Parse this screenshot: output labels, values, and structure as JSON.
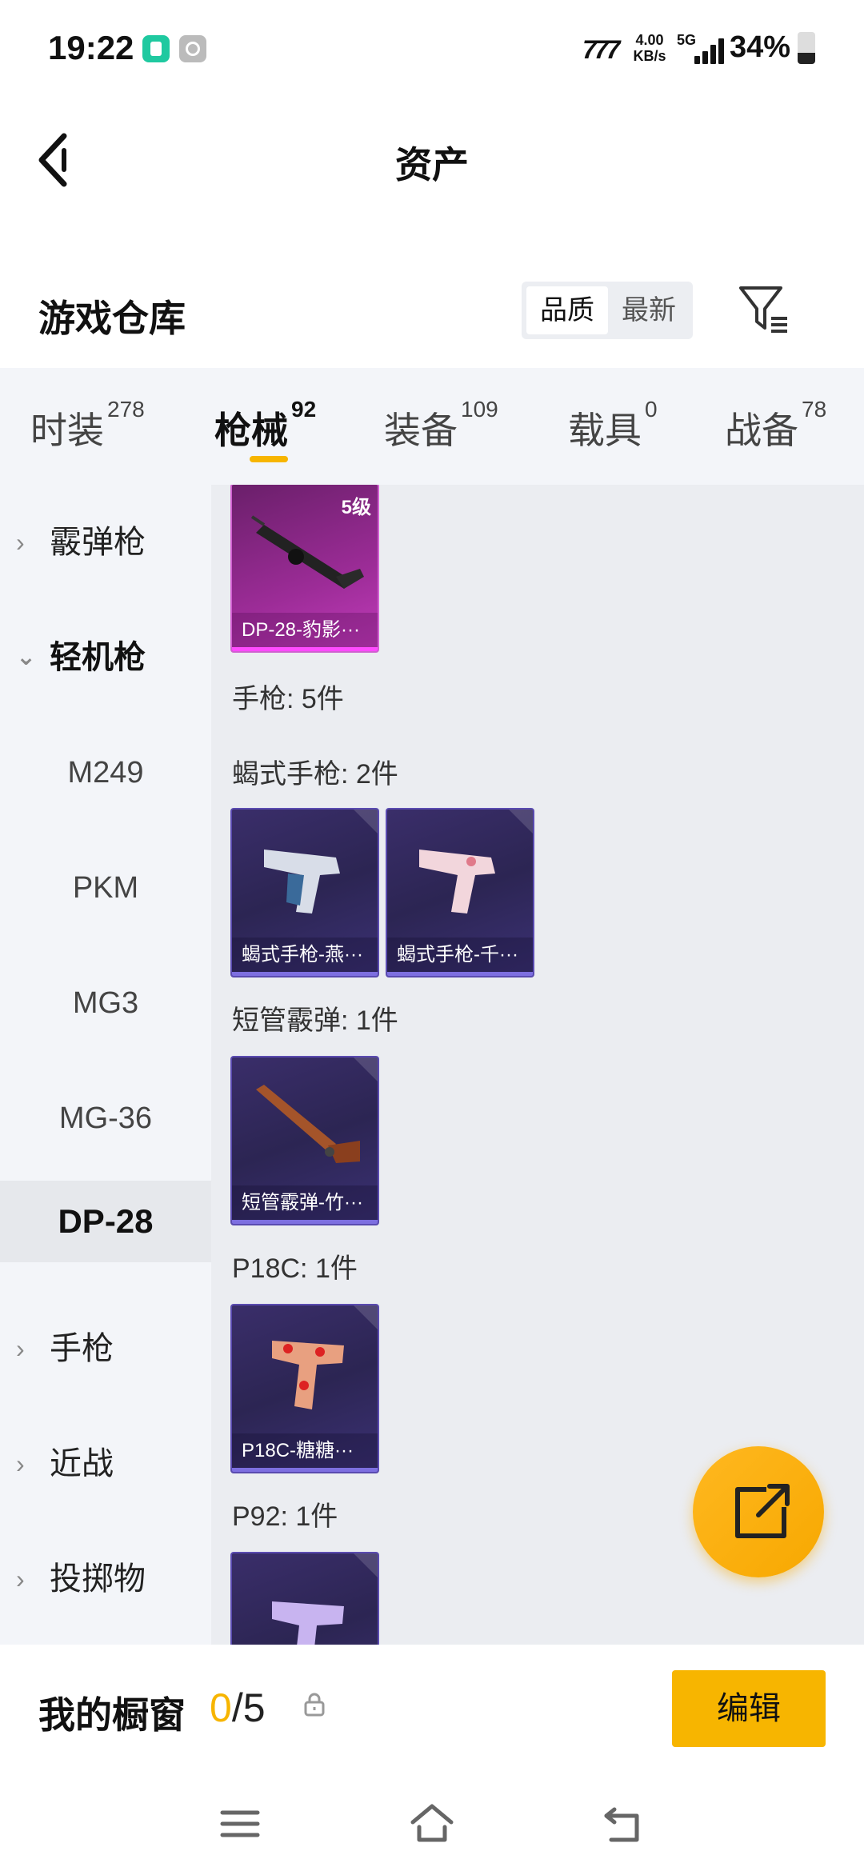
{
  "status_bar": {
    "time": "19:22",
    "net_logo": "777",
    "net_speed_value": "4.00",
    "net_speed_unit": "KB/s",
    "network": "5G",
    "battery": "34%"
  },
  "header": {
    "title": "资产",
    "back_icon": "chevron-left-icon"
  },
  "warehouse": {
    "title": "游戏仓库",
    "sort_options": [
      "品质",
      "最新"
    ],
    "sort_selected": "品质",
    "filter_icon": "filter-icon"
  },
  "tabs": [
    {
      "label": "时装",
      "count": "278"
    },
    {
      "label": "枪械",
      "count": "92",
      "active": true
    },
    {
      "label": "装备",
      "count": "109"
    },
    {
      "label": "载具",
      "count": "0"
    },
    {
      "label": "战备",
      "count": "78"
    }
  ],
  "sidebar": {
    "items": [
      {
        "label": "霰弹枪",
        "type": "group",
        "expanded": false
      },
      {
        "label": "轻机枪",
        "type": "group",
        "expanded": true
      },
      {
        "label": "M249",
        "type": "sub"
      },
      {
        "label": "PKM",
        "type": "sub"
      },
      {
        "label": "MG3",
        "type": "sub"
      },
      {
        "label": "MG-36",
        "type": "sub"
      },
      {
        "label": "DP-28",
        "type": "sub",
        "selected": true
      },
      {
        "label": "手枪",
        "type": "group",
        "expanded": false
      },
      {
        "label": "近战",
        "type": "group",
        "expanded": false
      },
      {
        "label": "投掷物",
        "type": "group",
        "expanded": false
      }
    ]
  },
  "content": {
    "dp28_card": {
      "label": "DP-28-豹影···",
      "level": "5级"
    },
    "pistol_total": "手枪: 5件",
    "groups": [
      {
        "title": "蝎式手枪: 2件",
        "cards": [
          {
            "label": "蝎式手枪-燕···"
          },
          {
            "label": "蝎式手枪-千···"
          }
        ]
      },
      {
        "title": "短管霰弹: 1件",
        "cards": [
          {
            "label": "短管霰弹-竹···"
          }
        ]
      },
      {
        "title": "P18C: 1件",
        "cards": [
          {
            "label": "P18C-糖糖···"
          }
        ]
      },
      {
        "title": "P92: 1件",
        "cards": [
          {
            "label": ""
          }
        ]
      }
    ]
  },
  "fab": {
    "icon": "share-external-icon"
  },
  "showcase": {
    "title": "我的橱窗",
    "current": "0",
    "separator_total": "/5",
    "lock_icon": "lock-icon",
    "edit_label": "编辑"
  },
  "navbar": {
    "menu_icon": "menu-icon",
    "home_icon": "home-icon",
    "back_icon": "back-icon"
  },
  "colors": {
    "accent": "#f7b500",
    "card_blue": "#2c2553",
    "card_purple": "#9c2c97"
  }
}
